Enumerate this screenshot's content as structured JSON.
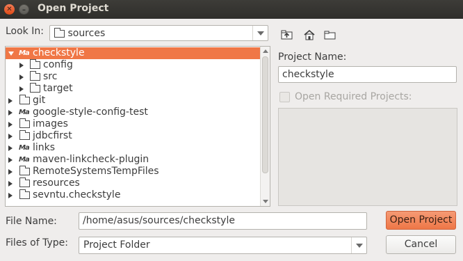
{
  "window": {
    "title": "Open Project",
    "close_glyph": "✕",
    "min_glyph": "–"
  },
  "look_in": {
    "label": "Look In:",
    "value": "sources"
  },
  "tree": {
    "items": [
      {
        "label": "checkstyle",
        "icon": "maven-icon",
        "expanded": true,
        "selected": true,
        "level": 0
      },
      {
        "label": "config",
        "icon": "folder-icon",
        "level": 1
      },
      {
        "label": "src",
        "icon": "folder-icon",
        "level": 1
      },
      {
        "label": "target",
        "icon": "folder-icon",
        "level": 1
      },
      {
        "label": "git",
        "icon": "folder-icon",
        "level": 0
      },
      {
        "label": "google-style-config-test",
        "icon": "maven-icon",
        "level": 0
      },
      {
        "label": "images",
        "icon": "folder-icon",
        "level": 0
      },
      {
        "label": "jdbcfirst",
        "icon": "folder-icon",
        "level": 0
      },
      {
        "label": "links",
        "icon": "maven-icon",
        "level": 0
      },
      {
        "label": "maven-linkcheck-plugin",
        "icon": "maven-icon",
        "level": 0
      },
      {
        "label": "RemoteSystemsTempFiles",
        "icon": "folder-icon",
        "level": 0
      },
      {
        "label": "resources",
        "icon": "folder-icon",
        "level": 0
      },
      {
        "label": "sevntu.checkstyle",
        "icon": "folder-icon",
        "level": 0
      }
    ]
  },
  "project_name": {
    "label": "Project Name:",
    "value": "checkstyle"
  },
  "required_projects": {
    "label": "Open Required Projects:"
  },
  "file_name": {
    "label": "File Name:",
    "value": "/home/asus/sources/checkstyle"
  },
  "files_of_type": {
    "label": "Files of Type:",
    "value": "Project Folder"
  },
  "buttons": {
    "open": "Open Project",
    "cancel": "Cancel"
  },
  "colors": {
    "accent": "#f07746",
    "titlebar": "#2f2e2b",
    "background": "#efedec"
  }
}
